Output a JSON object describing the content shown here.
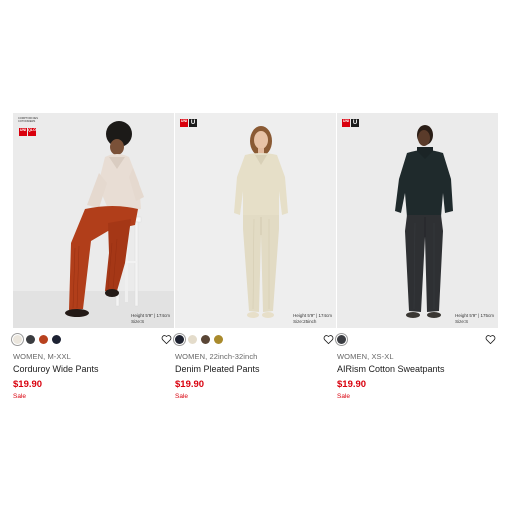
{
  "products": [
    {
      "name": "Corduroy Wide Pants",
      "meta": "WOMEN, M-XXL",
      "price": "$19.90",
      "flag": "Sale",
      "badge": "uniqlo-logo",
      "collab_text": "COMPTOIR DES COTONNIERS",
      "model_caption_height": "Height 5'9\" | 174cm",
      "model_caption_size": "Size:S",
      "swatches": [
        "#ebe6dd",
        "#3a3c40",
        "#b8411e",
        "#1d2233"
      ],
      "selected_swatch": 0,
      "photo_background": "#ebebeb"
    },
    {
      "name": "Denim Pleated Pants",
      "meta": "WOMEN, 22inch-32inch",
      "price": "$19.90",
      "flag": "Sale",
      "badge": "uniqlo-logo",
      "model_caption_height": "Height 5'9\" | 174cm",
      "model_caption_size": "Size:25inch",
      "swatches": [
        "#1e2230",
        "#e4dccb",
        "#5a4636",
        "#a98a2c"
      ],
      "selected_swatch": 0,
      "photo_background": "#eeeeee"
    },
    {
      "name": "AIRism Cotton Sweatpants",
      "meta": "WOMEN, XS-XL",
      "price": "$19.90",
      "flag": "Sale",
      "badge": "uniqlo-logo",
      "model_caption_height": "Height 5'9\" | 175cm",
      "model_caption_size": "Size:S",
      "swatches": [
        "#3b3d42"
      ],
      "selected_swatch": 0,
      "photo_background": "#ebebeb"
    }
  ],
  "icons": {
    "favorite": "heart-outline-icon"
  },
  "colors": {
    "price_red": "#d9000d",
    "brand_red": "#d9000d"
  }
}
